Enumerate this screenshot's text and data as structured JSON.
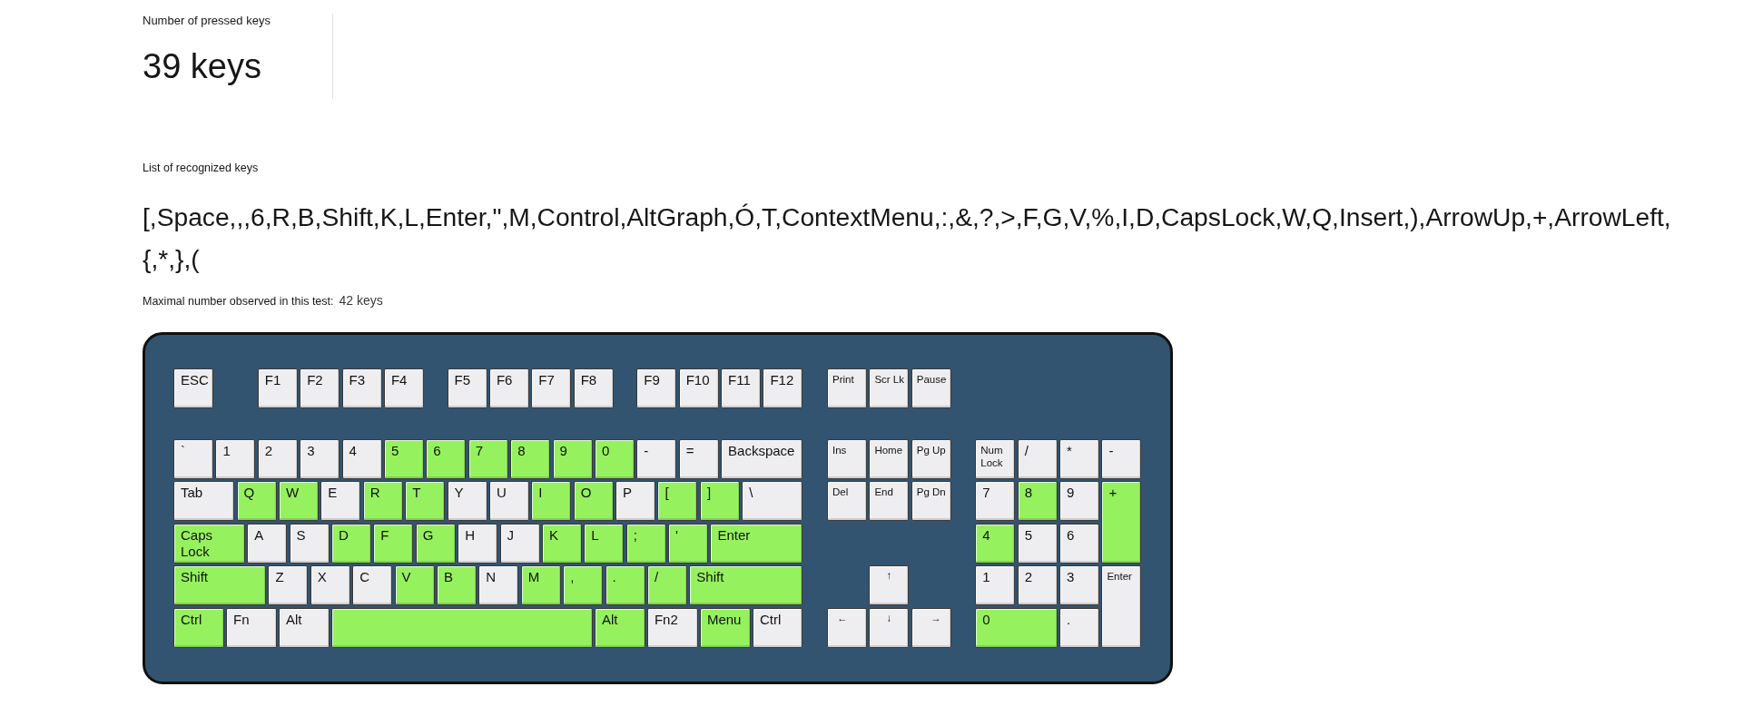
{
  "pressed_keys": {
    "label": "Number of pressed keys",
    "value": "39 keys"
  },
  "recognized_keys": {
    "label": "List of recognized keys",
    "text": "[,Space,,,6,R,B,Shift,K,L,Enter,\",M,Control,AltGraph,Ó,T,ContextMenu,:,&,?,>,F,G,V,%,I,D,CapsLock,W,Q,Insert,),ArrowUp,+,ArrowLeft,{,*,},("
  },
  "max_observed": {
    "label": "Maximal number observed in this test:",
    "value": "42 keys"
  },
  "keyboard": {
    "function_row": [
      {
        "label": "ESC",
        "pressed": false
      },
      {
        "label": "F1",
        "pressed": false
      },
      {
        "label": "F2",
        "pressed": false
      },
      {
        "label": "F3",
        "pressed": false
      },
      {
        "label": "F4",
        "pressed": false
      },
      {
        "label": "F5",
        "pressed": false
      },
      {
        "label": "F6",
        "pressed": false
      },
      {
        "label": "F7",
        "pressed": false
      },
      {
        "label": "F8",
        "pressed": false
      },
      {
        "label": "F9",
        "pressed": false
      },
      {
        "label": "F10",
        "pressed": false
      },
      {
        "label": "F11",
        "pressed": false
      },
      {
        "label": "F12",
        "pressed": false
      }
    ],
    "system_keys": [
      {
        "label": "Print",
        "pressed": false
      },
      {
        "label": "Scr Lk",
        "pressed": false
      },
      {
        "label": "Pause",
        "pressed": false
      }
    ],
    "main_rows": [
      [
        {
          "label": "`",
          "pressed": false
        },
        {
          "label": "1",
          "pressed": false
        },
        {
          "label": "2",
          "pressed": false
        },
        {
          "label": "3",
          "pressed": false
        },
        {
          "label": "4",
          "pressed": false
        },
        {
          "label": "5",
          "pressed": true
        },
        {
          "label": "6",
          "pressed": true
        },
        {
          "label": "7",
          "pressed": true
        },
        {
          "label": "8",
          "pressed": true
        },
        {
          "label": "9",
          "pressed": true
        },
        {
          "label": "0",
          "pressed": true
        },
        {
          "label": "-",
          "pressed": false
        },
        {
          "label": "=",
          "pressed": false
        },
        {
          "label": "Backspace",
          "pressed": false
        }
      ],
      [
        {
          "label": "Tab",
          "pressed": false
        },
        {
          "label": "Q",
          "pressed": true
        },
        {
          "label": "W",
          "pressed": true
        },
        {
          "label": "E",
          "pressed": false
        },
        {
          "label": "R",
          "pressed": true
        },
        {
          "label": "T",
          "pressed": true
        },
        {
          "label": "Y",
          "pressed": false
        },
        {
          "label": "U",
          "pressed": false
        },
        {
          "label": "I",
          "pressed": true
        },
        {
          "label": "O",
          "pressed": true
        },
        {
          "label": "P",
          "pressed": false
        },
        {
          "label": "[",
          "pressed": true
        },
        {
          "label": "]",
          "pressed": true
        },
        {
          "label": "\\",
          "pressed": false
        }
      ],
      [
        {
          "label": "Caps Lock",
          "pressed": true
        },
        {
          "label": "A",
          "pressed": false
        },
        {
          "label": "S",
          "pressed": false
        },
        {
          "label": "D",
          "pressed": true
        },
        {
          "label": "F",
          "pressed": true
        },
        {
          "label": "G",
          "pressed": true
        },
        {
          "label": "H",
          "pressed": false
        },
        {
          "label": "J",
          "pressed": false
        },
        {
          "label": "K",
          "pressed": true
        },
        {
          "label": "L",
          "pressed": true
        },
        {
          "label": ";",
          "pressed": true
        },
        {
          "label": "'",
          "pressed": true
        },
        {
          "label": "Enter",
          "pressed": true
        }
      ],
      [
        {
          "label": "Shift",
          "pressed": true
        },
        {
          "label": "Z",
          "pressed": false
        },
        {
          "label": "X",
          "pressed": false
        },
        {
          "label": "C",
          "pressed": false
        },
        {
          "label": "V",
          "pressed": true
        },
        {
          "label": "B",
          "pressed": true
        },
        {
          "label": "N",
          "pressed": false
        },
        {
          "label": "M",
          "pressed": true
        },
        {
          "label": ",",
          "pressed": true
        },
        {
          "label": ".",
          "pressed": true
        },
        {
          "label": "/",
          "pressed": true
        },
        {
          "label": "Shift",
          "pressed": true
        }
      ],
      [
        {
          "label": "Ctrl",
          "pressed": true
        },
        {
          "label": "Fn",
          "pressed": false
        },
        {
          "label": "Alt",
          "pressed": false
        },
        {
          "pressed": true
        },
        {
          "label": "Alt",
          "pressed": true
        },
        {
          "label": "Fn2",
          "pressed": false
        },
        {
          "label": "Menu",
          "pressed": true
        },
        {
          "label": "Ctrl",
          "pressed": false
        }
      ]
    ],
    "navigation_keys": [
      {
        "label": "Ins",
        "pressed": false
      },
      {
        "label": "Home",
        "pressed": false
      },
      {
        "label": "Pg Up",
        "pressed": false
      },
      {
        "label": "Del",
        "pressed": false
      },
      {
        "label": "End",
        "pressed": false
      },
      {
        "label": "Pg Dn",
        "pressed": false
      }
    ],
    "arrow_keys": [
      {
        "label": "↑",
        "pressed": false
      },
      {
        "label": "←",
        "pressed": false
      },
      {
        "label": "↓",
        "pressed": false
      },
      {
        "label": "→",
        "pressed": false
      }
    ],
    "numpad_keys": [
      {
        "label": "Num Lock",
        "pressed": false
      },
      {
        "label": "/",
        "pressed": false
      },
      {
        "label": "*",
        "pressed": false
      },
      {
        "label": "-",
        "pressed": false
      },
      {
        "label": "7",
        "pressed": false
      },
      {
        "label": "8",
        "pressed": true
      },
      {
        "label": "9",
        "pressed": false
      },
      {
        "label": "+",
        "pressed": true
      },
      {
        "label": "4",
        "pressed": true
      },
      {
        "label": "5",
        "pressed": false
      },
      {
        "label": "6",
        "pressed": false
      },
      {
        "label": "1",
        "pressed": false
      },
      {
        "label": "2",
        "pressed": false
      },
      {
        "label": "3",
        "pressed": false
      },
      {
        "label": "Enter",
        "pressed": false
      },
      {
        "label": "0",
        "pressed": true
      },
      {
        "label": ".",
        "pressed": false
      }
    ]
  }
}
